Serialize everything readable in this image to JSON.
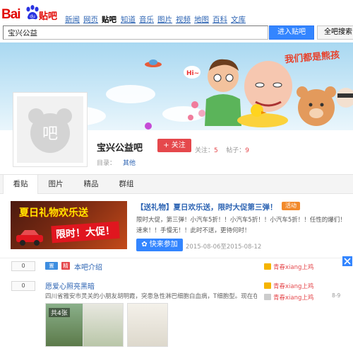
{
  "header": {
    "logo_text": "Bai",
    "logo_suffix": "贴吧",
    "nav": [
      "新闻",
      "网页",
      "贴吧",
      "知道",
      "音乐",
      "图片",
      "视频",
      "地图",
      "百科",
      "文库"
    ]
  },
  "search": {
    "value": "宝兴公益",
    "enter_label": "进入贴吧",
    "all_label": "全吧搜索"
  },
  "banner": {
    "slogan": "我们都是熊孩"
  },
  "forum": {
    "name": "宝兴公益吧",
    "follow_label": "+ 关注",
    "follow_stat_label": "关注：",
    "follow_count": "5",
    "post_stat_label": "帖子：",
    "post_count": "9",
    "dir_label": "目录：",
    "dir_value": "其他"
  },
  "tabs": [
    "看贴",
    "图片",
    "精品",
    "群组"
  ],
  "promo": {
    "image_line1": "夏日礼物欢乐送",
    "image_line2": "限时！大促！",
    "title": "【送礼物】夏日欢乐送，限时大促第三弹！",
    "badge": "活动",
    "desc": "限时大促，第三弹！小汽车5折！！小汽车5折！！小汽车5折！！任性的爆们！速来！！手慢无！！此时不送，更待何时！",
    "join_label": "快来参加",
    "date_range": "2015-08-06至2015-08-12"
  },
  "threads": [
    {
      "count": "0",
      "tag1": "置顶",
      "tag2": "精",
      "title": "本吧介绍",
      "author": "青春xiang上鸡"
    },
    {
      "count": "0",
      "title": "愿爱心照亮黑暗",
      "author": "青春xiang上鸡",
      "reply_author": "青春xiang上鸡",
      "snippet": "四川省雅安市灵关的小朋友胡明霞，突患急性淋巴细胞白血病，T细胞型。现在在华…",
      "time": "8-9",
      "thumb_count": "共4张"
    }
  ]
}
